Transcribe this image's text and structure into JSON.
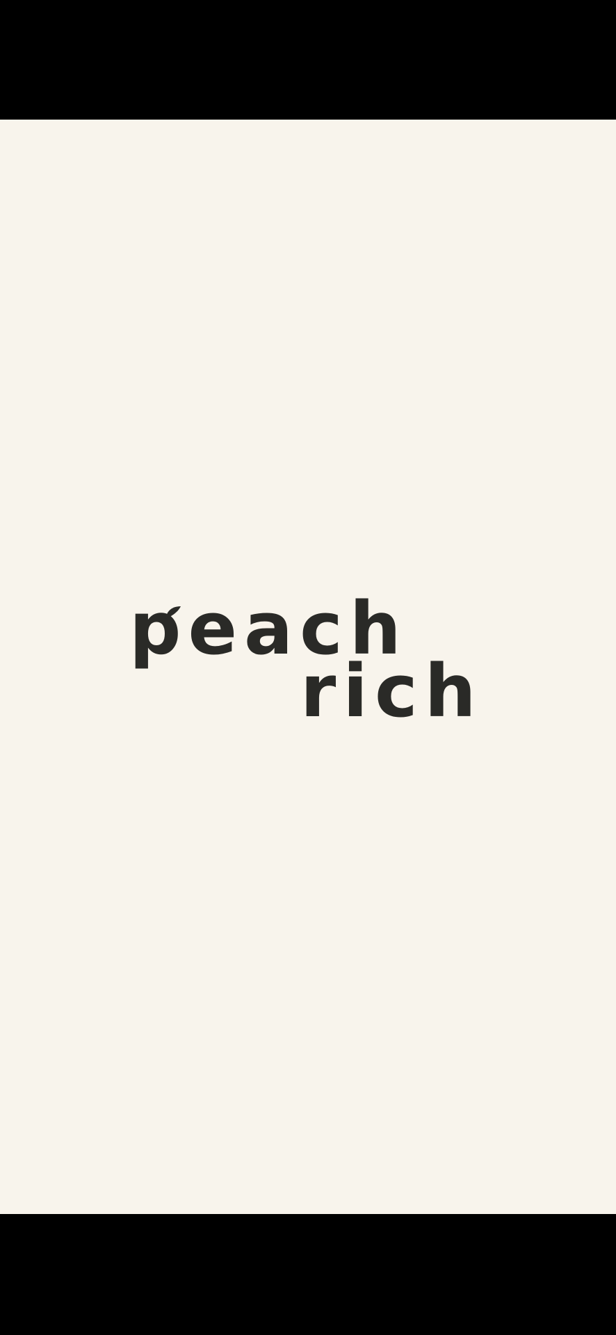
{
  "logo": {
    "line1": "peach",
    "line2": "rich",
    "text_color": "#2a2a27"
  },
  "colors": {
    "background": "#f8f4ec",
    "frame": "#000000"
  },
  "icons": {
    "logo_mark": "leaf-icon"
  }
}
